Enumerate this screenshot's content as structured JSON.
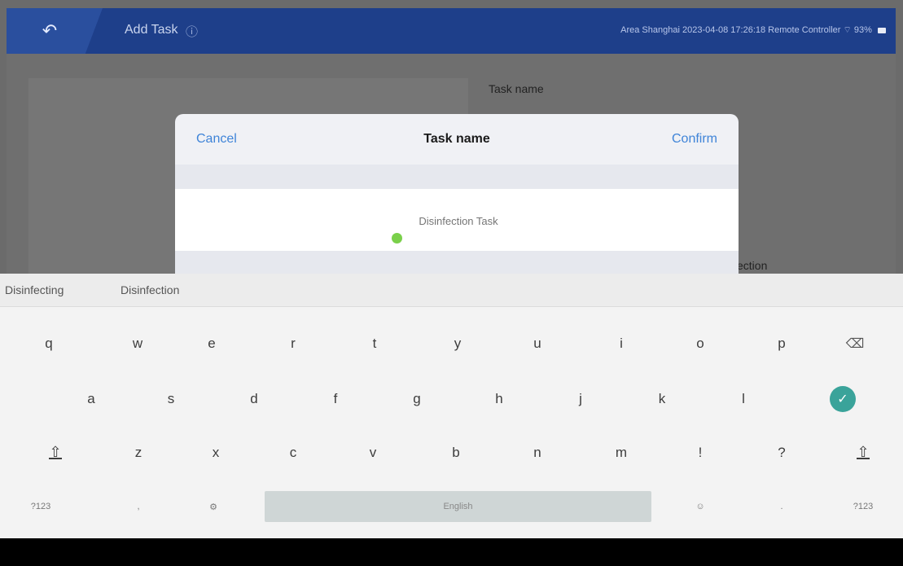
{
  "topbar": {
    "back_icon": "back-arrow-icon",
    "title": "Add Task",
    "title_icon": "info-icon",
    "status": "Area Shanghai 2023-04-08 17:26:18 Remote Controller",
    "battery": "93%"
  },
  "background": {
    "label_task_name": "Task name",
    "label_partial": "ection"
  },
  "modal": {
    "cancel": "Cancel",
    "title": "Task name",
    "confirm": "Confirm",
    "input_placeholder": "Disinfection Task"
  },
  "suggestions": [
    "Disinfecting",
    "Disinfection"
  ],
  "keyboard": {
    "row1": [
      "q",
      "w",
      "e",
      "r",
      "t",
      "y",
      "u",
      "i",
      "o",
      "p"
    ],
    "row2": [
      "a",
      "s",
      "d",
      "f",
      "g",
      "h",
      "j",
      "k",
      "l"
    ],
    "row3": [
      "z",
      "x",
      "c",
      "v",
      "b",
      "n",
      "m",
      "!",
      "?"
    ],
    "left_mode": "?123",
    "comma": ",",
    "space": "English",
    "period": ".",
    "right_mode": "?123"
  },
  "colors": {
    "topbar": "#1e3f8a",
    "accent_blue": "#3f84d8",
    "enter_green": "#3aa39a",
    "cursor_green": "#7ad04a"
  }
}
